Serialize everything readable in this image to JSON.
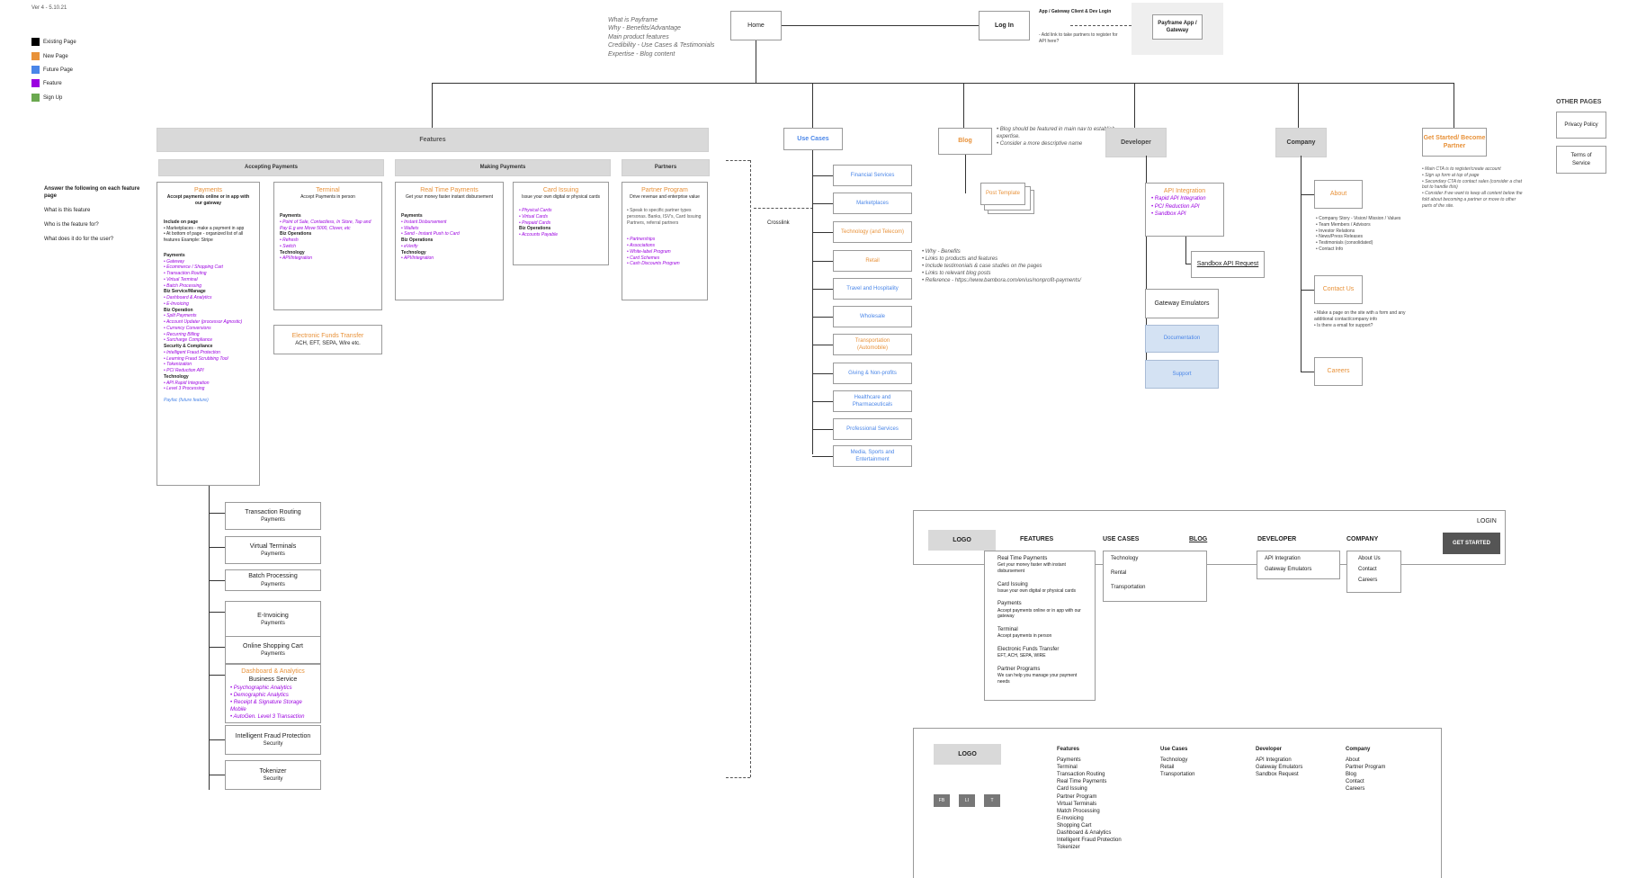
{
  "version": "Ver 4 - 5.10.21",
  "legend": [
    {
      "label": "Existing Page",
      "color": "#000000"
    },
    {
      "label": "New Page",
      "color": "#e8923a"
    },
    {
      "label": "Future Page",
      "color": "#4a86e8"
    },
    {
      "label": "Feature",
      "color": "#9b00e0"
    },
    {
      "label": "Sign Up",
      "color": "#6aa84f"
    }
  ],
  "questions": {
    "title": "Answer the following on each feature page",
    "items": [
      "What is this feature",
      "Who is the feature for?",
      "What does it do for the user?"
    ]
  },
  "home_notes": [
    "What is Payframe",
    "Why - Benefits/Advantage",
    "Main product features",
    "Credibility - Use Cases & Testimonials",
    "Expertise - Blog content"
  ],
  "home": "Home",
  "login": "Log In",
  "login_notes": {
    "title": "App / Gateway Client & Dev Login",
    "sub": "- Add link to take partners to register for API here?"
  },
  "payframe_app": "Payframe App / Gateway",
  "features_header": "Features",
  "features_sub": [
    "Accepting Payments",
    "Making Payments",
    "Partners"
  ],
  "payments_card": {
    "title": "Payments",
    "subtitle": "Accept payments online or in app with our gateway",
    "include_title": "Include on page",
    "include_items": [
      "Marketplaces - make a payment in app",
      "At bottom of page - organized list of all features Example: Stripe"
    ],
    "sections": [
      {
        "head": "Payments",
        "items": [
          "Gateway",
          "Ecommerce / Shopping Cart",
          "Transaction Routing",
          "Virtual Terminal",
          "Batch Processing"
        ]
      },
      {
        "head": "Biz Service/Manage",
        "items": [
          "Dashboard & Analytics",
          "E-Invoicing"
        ]
      },
      {
        "head": "Biz Operation",
        "items": [
          "Split Payments",
          "Account Updater (processor Agnostic)",
          "Currency Conversions",
          "Recurring Billing",
          "Surcharge Compliance"
        ]
      },
      {
        "head": "Security & Compliance",
        "items": [
          "Intelligent Fraud Protection",
          "Learning Fraud Scrubbing Tool",
          "Tokenization",
          "PCI Reduction API"
        ]
      },
      {
        "head": "Technology",
        "items": [
          "API Rapid Integration",
          "Level 3 Processing"
        ]
      }
    ],
    "future": "Payfac (future feature)"
  },
  "terminal_card": {
    "title": "Terminal",
    "subtitle": "Accept Payments in person",
    "sections": [
      {
        "head": "Payments",
        "items": [
          "Point of Sale, Contactless, In Store, Tap and Pay E.g are Move 5000, Clover, etc"
        ]
      },
      {
        "head": "Biz Operations",
        "items": [
          "Refresh",
          "Switch"
        ]
      },
      {
        "head": "Technology",
        "items": [
          "API/Integration"
        ]
      }
    ]
  },
  "eft_card": {
    "title": "Electronic Funds Transfer",
    "subtitle": "ACH, EFT, SEPA, Wire etc."
  },
  "rtp_card": {
    "title": "Real Time Payments",
    "subtitle": "Get your money faster instant disbursement",
    "sections": [
      {
        "head": "Payments",
        "items": [
          "Instant Disbursement",
          "Wallets",
          "Send - Instant Push to Card"
        ]
      },
      {
        "head": "Biz Operations",
        "items": [
          "eVerify"
        ]
      },
      {
        "head": "Technology",
        "items": [
          "API/Integration"
        ]
      }
    ]
  },
  "card_issuing": {
    "title": "Card Issuing",
    "subtitle": "Issue your own digital or physical cards",
    "items": [
      "Physical Cards",
      "Virtual Cards",
      "Prepaid Cards"
    ],
    "ops_head": "Biz Operations",
    "ops_items": [
      "Accounts Payable"
    ]
  },
  "partner_program": {
    "title": "Partner Program",
    "subtitle": "Drive revenue and enterprise value",
    "note": "Speak to specific partner types personas. Banks, ISV's, Card Issuing Partners, referral partners",
    "items": [
      "Partnerships",
      "Associations",
      "White-label Program",
      "Card Schemes",
      "Cash Discounts Program"
    ]
  },
  "feature_pages": [
    {
      "title": "Transaction Routing",
      "sub": "Payments"
    },
    {
      "title": "Virtual Terminals",
      "sub": "Payments"
    },
    {
      "title": "Batch Processing",
      "sub": "Payments"
    },
    {
      "title": "E-Invoicing",
      "sub": "Payments"
    },
    {
      "title": "Online Shopping Cart",
      "sub": "Payments"
    }
  ],
  "dashboard_card": {
    "title": "Dashboard & Analytics",
    "sub": "Business Service",
    "items": [
      "Psychographic Analytics",
      "Demographic Analytics",
      "Receipt & Signature Storage Mobile",
      "AutoGen. Level 3 Transaction"
    ]
  },
  "security_pages": [
    {
      "title": "Intelligent Fraud Protection",
      "sub": "Security"
    },
    {
      "title": "Tokenizer",
      "sub": "Security"
    }
  ],
  "crosslink": "Crosslink",
  "use_cases": {
    "title": "Use Cases",
    "items": [
      "Financial Services",
      "Marketplaces",
      "Technology (and Telecom)",
      "Retail",
      "Travel and Hospitality",
      "Wholesale",
      "Transportation (Automobile)",
      "Giving & Non-profits",
      "Healthcare and Pharmaceuticals",
      "Professional Services",
      "Media, Sports and Entertainment"
    ]
  },
  "blog": {
    "title": "Blog",
    "notes": [
      "Blog should be featured in main nav to establish expertise.",
      "Consider a more descriptive name"
    ],
    "post_template": "Post Template"
  },
  "usecase_notes": [
    "Why - Benefits",
    "Links to products and features",
    "Include testimonials & case studies on the pages",
    "Links to relevant blog posts",
    "Reference - https://www.bambora.com/en/us/nonprofit-payments/"
  ],
  "developer": {
    "title": "Developer",
    "api_title": "API Integration",
    "api_items": [
      "Rapid API Integration",
      "PCI Reduction API",
      "Sandbox API"
    ],
    "sandbox_request": "Sandbox API Request",
    "emulators": "Gateway Emulators",
    "documentation": "Documentation",
    "support": "Support"
  },
  "company": {
    "title": "Company",
    "about": "About",
    "about_items": [
      "Company Story - Vision/ Mission / Values",
      "Team Members / Advisors",
      "Investor Relations",
      "News/Press Releases",
      "Testimonials (consolidated)",
      "Contact Info"
    ],
    "contact": "Contact Us",
    "contact_items": [
      "Make a page on the site with a form and any additional contact/company info",
      "Is there a email for support?"
    ],
    "careers": "Careers"
  },
  "get_started": {
    "title": "Get Started/ Become Partner",
    "notes": [
      "Main CTA is to register/create account",
      "Sign up form at top of page",
      "Secondary CTA to contact sales (consider a chat bot to handle this)",
      "Consider if we want to keep all content below the fold about becoming a partner or move to other parts of the site."
    ]
  },
  "other_pages": {
    "title": "OTHER PAGES",
    "items": [
      "Privacy Policy",
      "Terms of Service"
    ]
  },
  "nav_mock": {
    "login": "LOGIN",
    "logo": "LOGO",
    "menu": [
      "FEATURES",
      "USE CASES",
      "BLOG",
      "DEVELOPER",
      "COMPANY"
    ],
    "cta": "GET STARTED",
    "features_dropdown": [
      {
        "title": "Real Time Payments",
        "sub": "Get your money faster with instant disbursement"
      },
      {
        "title": "Card Issuing",
        "sub": "Issue your own digital or physical cards"
      },
      {
        "title": "Payments",
        "sub": "Accept payments online or in app with our gateway"
      },
      {
        "title": "Terminal",
        "sub": "Accept payments in person"
      },
      {
        "title": "Electronic Funds Transfer",
        "sub": "EFT, ACH, SEPA, WIRE"
      },
      {
        "title": "Partner Programs",
        "sub": "We can help you manage your payment needs"
      }
    ],
    "usecases_dropdown": [
      "Technology",
      "Rental",
      "Transportation"
    ],
    "developer_dropdown": [
      "API Integration",
      "Gateway Emulators"
    ],
    "company_dropdown": [
      "About Us",
      "Contact",
      "Careers"
    ]
  },
  "footer_mock": {
    "logo": "LOGO",
    "social": [
      "FB",
      "LI",
      "T"
    ],
    "columns": [
      {
        "head": "Features",
        "items": [
          "Payments",
          "Terminal",
          "Transaction Routing",
          "Real Time Payments",
          "Card Issuing",
          "Partner Program",
          "Virtual Terminals",
          "Match Processing",
          "E-Invoicing",
          "Shopping Cart",
          "Dashboard & Analytics",
          "Intelligent Fraud Protection",
          "Tokenizer"
        ]
      },
      {
        "head": "Use Cases",
        "items": [
          "Technology",
          "Retail",
          "Transportation"
        ]
      },
      {
        "head": "Developer",
        "items": [
          "API Integration",
          "Gateway Emulators",
          "Sandbox Request"
        ]
      },
      {
        "head": "Company",
        "items": [
          "About",
          "Partner Program",
          "Blog",
          "Contact",
          "Careers"
        ]
      }
    ]
  }
}
